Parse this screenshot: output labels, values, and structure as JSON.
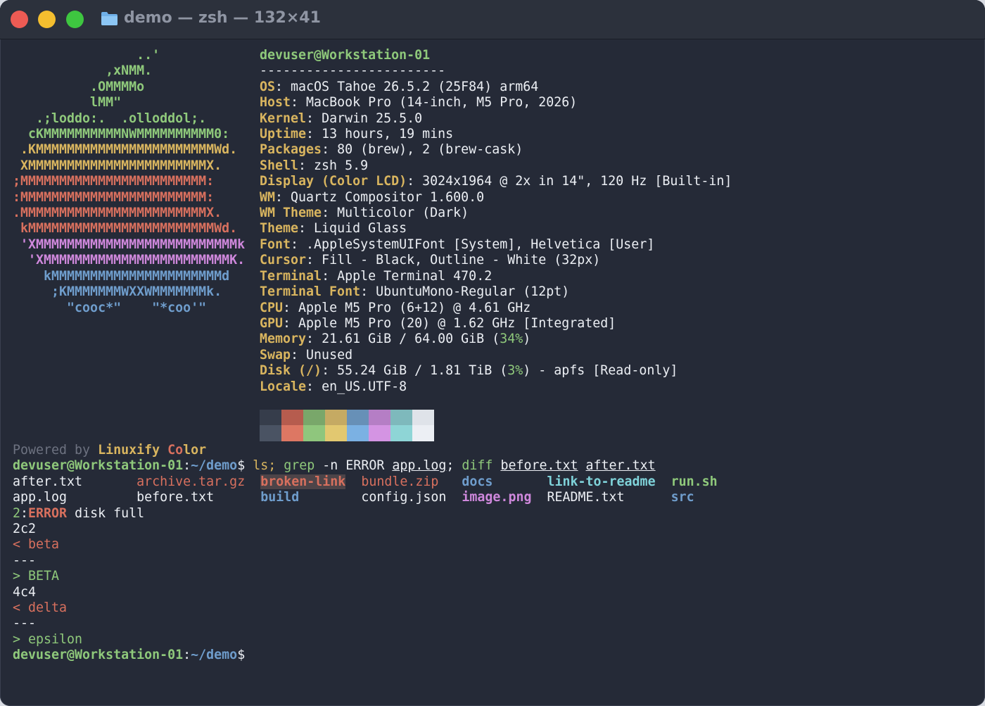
{
  "window": {
    "title": "demo — zsh — 132×41"
  },
  "logo": {
    "lines": [
      {
        "text": "                ..'",
        "color": "#8fc97b"
      },
      {
        "text": "            ,xNMM.",
        "color": "#8fc97b"
      },
      {
        "text": "          .OMMMMo",
        "color": "#8fc97b"
      },
      {
        "text": "          lMM\"",
        "color": "#8fc97b"
      },
      {
        "text": "   .;loddo:.  .olloddol;.",
        "color": "#8fc97b"
      },
      {
        "text": "  cKMMMMMMMMMMNWMMMMMMMMMM0:",
        "color": "#8fc97b"
      },
      {
        "text": " .KMMMMMMMMMMMMMMMMMMMMMMMWd.",
        "color": "#d9b55f"
      },
      {
        "text": " XMMMMMMMMMMMMMMMMMMMMMMMX.",
        "color": "#d9b55f"
      },
      {
        "text": ";MMMMMMMMMMMMMMMMMMMMMMMM:",
        "color": "#d8705e"
      },
      {
        "text": ":MMMMMMMMMMMMMMMMMMMMMMMM:",
        "color": "#d8705e"
      },
      {
        "text": ".MMMMMMMMMMMMMMMMMMMMMMMMX.",
        "color": "#d8705e"
      },
      {
        "text": " kMMMMMMMMMMMMMMMMMMMMMMMMWd.",
        "color": "#d8705e"
      },
      {
        "text": " 'XMMMMMMMMMMMMMMMMMMMMMMMMMMk",
        "color": "#cf88dc"
      },
      {
        "text": "  'XMMMMMMMMMMMMMMMMMMMMMMMMK.",
        "color": "#cf88dc"
      },
      {
        "text": "    kMMMMMMMMMMMMMMMMMMMMMMd",
        "color": "#6f9dcc"
      },
      {
        "text": "     ;KMMMMMMMWXXWMMMMMMMk.",
        "color": "#6f9dcc"
      },
      {
        "text": "       \"cooc*\"    \"*coo'\"",
        "color": "#6f9dcc"
      }
    ]
  },
  "info": {
    "user_host": "devuser@Workstation-01",
    "separator": "------------------------",
    "rows": [
      {
        "key": "OS",
        "value": "macOS Tahoe 26.5.2 (25F84) arm64"
      },
      {
        "key": "Host",
        "value": "MacBook Pro (14-inch, M5 Pro, 2026)"
      },
      {
        "key": "Kernel",
        "value": "Darwin 25.5.0"
      },
      {
        "key": "Uptime",
        "value": "13 hours, 19 mins"
      },
      {
        "key": "Packages",
        "value": "80 (brew), 2 (brew-cask)"
      },
      {
        "key": "Shell",
        "value": "zsh 5.9"
      },
      {
        "key": "Display (Color LCD)",
        "value": "3024x1964 @ 2x in 14\", 120 Hz [Built-in]"
      },
      {
        "key": "WM",
        "value": "Quartz Compositor 1.600.0"
      },
      {
        "key": "WM Theme",
        "value": "Multicolor (Dark)"
      },
      {
        "key": "Theme",
        "value": "Liquid Glass"
      },
      {
        "key": "Font",
        "value": ".AppleSystemUIFont [System], Helvetica [User]"
      },
      {
        "key": "Cursor",
        "value": "Fill - Black, Outline - White (32px)"
      },
      {
        "key": "Terminal",
        "value": "Apple Terminal 470.2"
      },
      {
        "key": "Terminal Font",
        "value": "UbuntuMono-Regular (12pt)"
      },
      {
        "key": "CPU",
        "value": "Apple M5 Pro (6+12) @ 4.61 GHz"
      },
      {
        "key": "GPU",
        "value": "Apple M5 Pro (20) @ 1.62 GHz [Integrated]"
      }
    ],
    "memory": {
      "key": "Memory",
      "pre": "21.61 GiB / 64.00 GiB (",
      "pct": "34%",
      "post": ")"
    },
    "swap": {
      "key": "Swap",
      "value": "Unused"
    },
    "disk": {
      "key": "Disk (/)",
      "pre": "55.24 GiB / 1.81 TiB (",
      "pct": "3%",
      "post": ") - apfs [Read-only]"
    },
    "locale": {
      "key": "Locale",
      "value": "en_US.UTF-8"
    }
  },
  "palette": {
    "top": [
      "#363d4b",
      "#b65c4e",
      "#79a76a",
      "#c5aa63",
      "#6790b7",
      "#b57ec5",
      "#7eb9bc",
      "#dfe3e9"
    ],
    "bottom": [
      "#4a5363",
      "#dd7763",
      "#8fc67d",
      "#e2c870",
      "#7bb1e3",
      "#d494e3",
      "#8ed5d6",
      "#eceff4"
    ]
  },
  "shell": {
    "powered_prefix": "Powered by ",
    "powered_brand_a": "Linuxify ",
    "powered_brand_b": "Co",
    "powered_brand_c": "lor",
    "prompt": {
      "user": "devuser@Workstation-01",
      "colon": ":",
      "path": "~/demo",
      "symbol": "$"
    },
    "command": {
      "p1": " ls; ",
      "grep": "grep",
      "p2": " -n ERROR ",
      "file1": "app.log",
      "p3": "; ",
      "diff": "diff",
      "p4": " ",
      "file2": "before.txt",
      "p5": " ",
      "file3": "after.txt"
    },
    "ls_row1": [
      "after.txt",
      "archive.tar.gz",
      "broken-link",
      "bundle.zip",
      "docs",
      "link-to-readme",
      "run.sh"
    ],
    "ls_row2": [
      "app.log",
      "before.txt",
      "build",
      "config.json",
      "image.png",
      "README.txt",
      "src"
    ],
    "grep_line": {
      "num": "2",
      "colon": ":",
      "match": "ERROR",
      "rest": " disk full"
    },
    "diff_lines": [
      "2c2",
      "< beta",
      "---",
      "> BETA",
      "4c4",
      "< delta",
      "---",
      "> epsilon"
    ],
    "final_prompt": {
      "user": "devuser@Workstation-01",
      "colon": ":",
      "path": "~/demo",
      "symbol": "$"
    }
  }
}
